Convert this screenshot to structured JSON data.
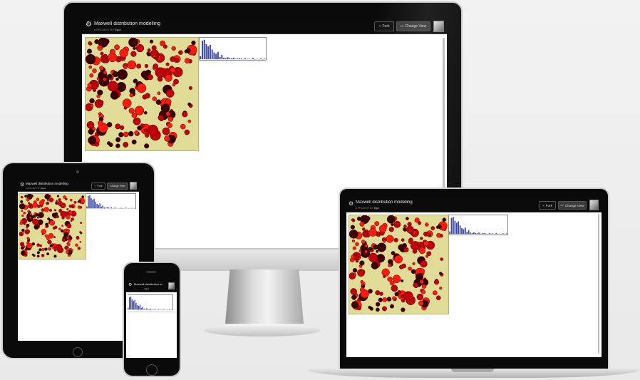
{
  "project": {
    "title": "Maxwell distribution modelling",
    "subtitle_prefix": "a PROJECT BY",
    "author": "Egor",
    "title_short": "Maxwell distribution m...",
    "subtitle_short": "- - - - - - - -",
    "fork_label": "Fork",
    "change_view_label": "Change View",
    "short_change_view_label": "Change View"
  },
  "icons": {
    "logo": "gear-logo-icon",
    "fork": "fork-icon",
    "change_view": "change-view-icon",
    "avatar": "user-avatar"
  },
  "colors": {
    "sim_background": "#e0dc98",
    "particle_bright": "#ff1a0f",
    "particle_mid": "#c0000a",
    "particle_dark": "#3a0005",
    "histogram_bar": "#3c47a8",
    "topbar": "#0b0b0b"
  },
  "histogram": {
    "type": "bar",
    "values": [
      0.15,
      0.95,
      1.0,
      0.78,
      0.66,
      0.74,
      0.5,
      0.35,
      0.28,
      0.38,
      0.12,
      0.22,
      0.08,
      0.05,
      0.1,
      0.06,
      0.04,
      0.08,
      0.02,
      0.04,
      0.05,
      0.03,
      0.01,
      0.05,
      0.02,
      0.03,
      0.01,
      0.06,
      0.0,
      0.02,
      0.0,
      0.04,
      0.0,
      0.03
    ]
  }
}
